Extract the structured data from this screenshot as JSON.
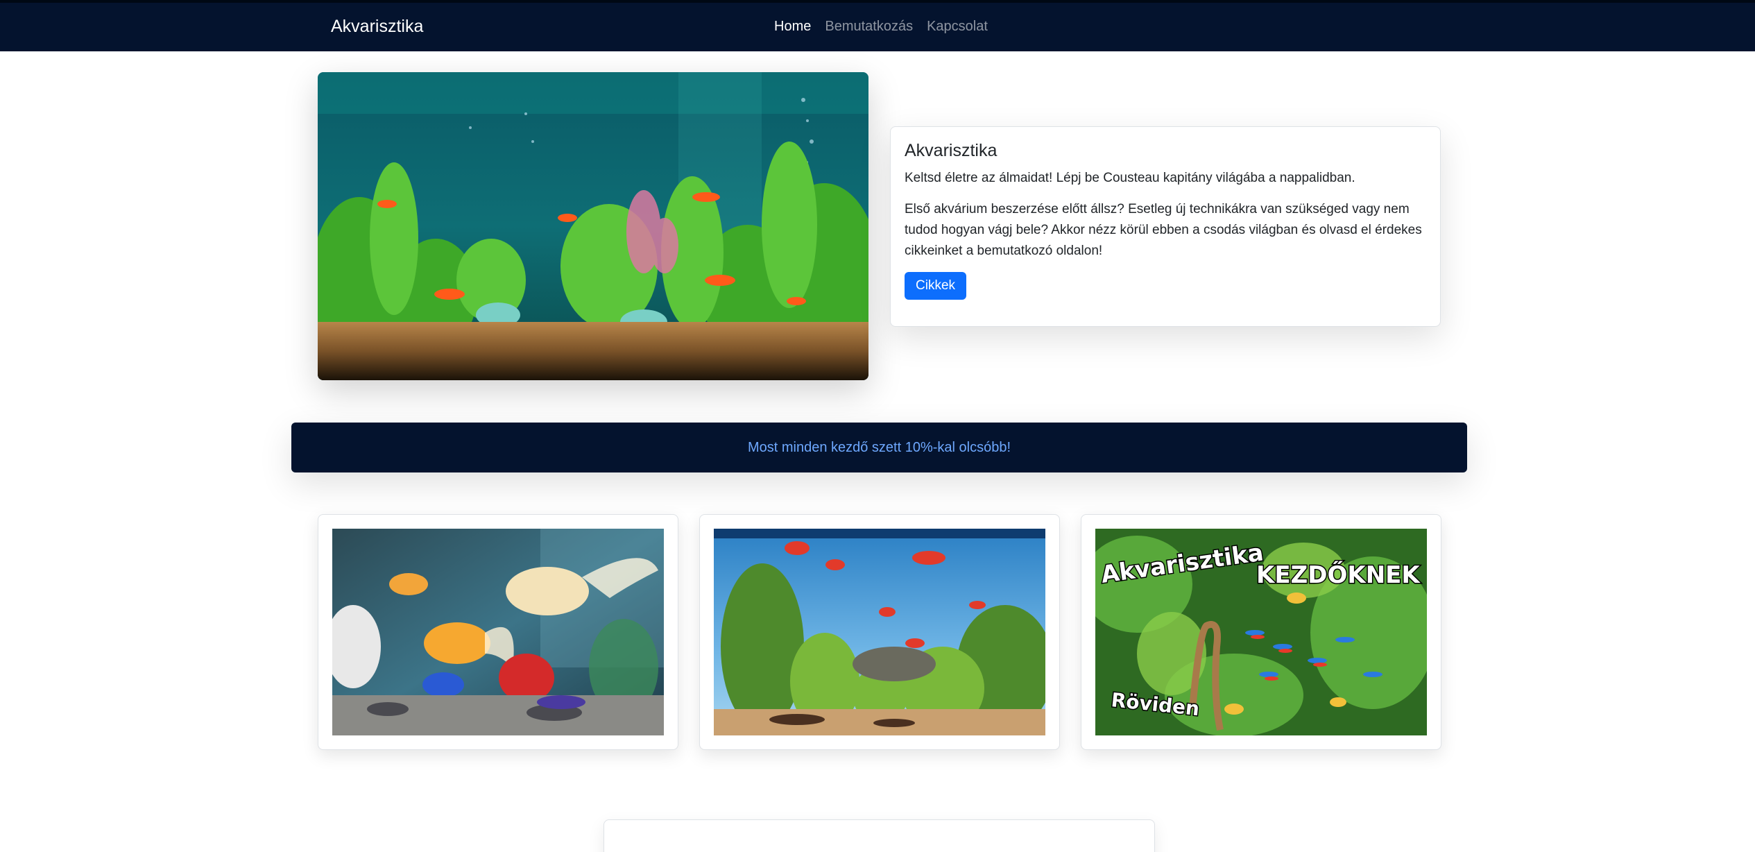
{
  "navbar": {
    "brand": "Akvarisztika",
    "links": [
      {
        "label": "Home",
        "active": true
      },
      {
        "label": "Bemutatkozás",
        "active": false
      },
      {
        "label": "Kapcsolat",
        "active": false
      }
    ]
  },
  "hero": {
    "title": "Akvarisztika",
    "lead": "Keltsd életre az álmaidat! Lépj be Cousteau kapitány világába a nappalidban.",
    "body": "Első akvárium beszerzése előtt állsz? Esetleg új technikákra van szükséged vagy nem tudod hogyan vágj bele? Akkor nézz körül ebben a csodás világban és olvasd el érdekes cikkeinket a bemutatkozó oldalon!",
    "button": "Cikkek"
  },
  "promo": {
    "text": "Most minden kezdő szett 10%-kal olcsóbb!"
  },
  "gallery": {
    "card3_overlay": {
      "line1": "Akvarisztika",
      "line2": "KEZDŐKNEK",
      "line3": "Röviden"
    }
  },
  "colors": {
    "navbar_bg": "#04132e",
    "primary": "#0d6efd",
    "promo_text": "#6ea8fe"
  }
}
